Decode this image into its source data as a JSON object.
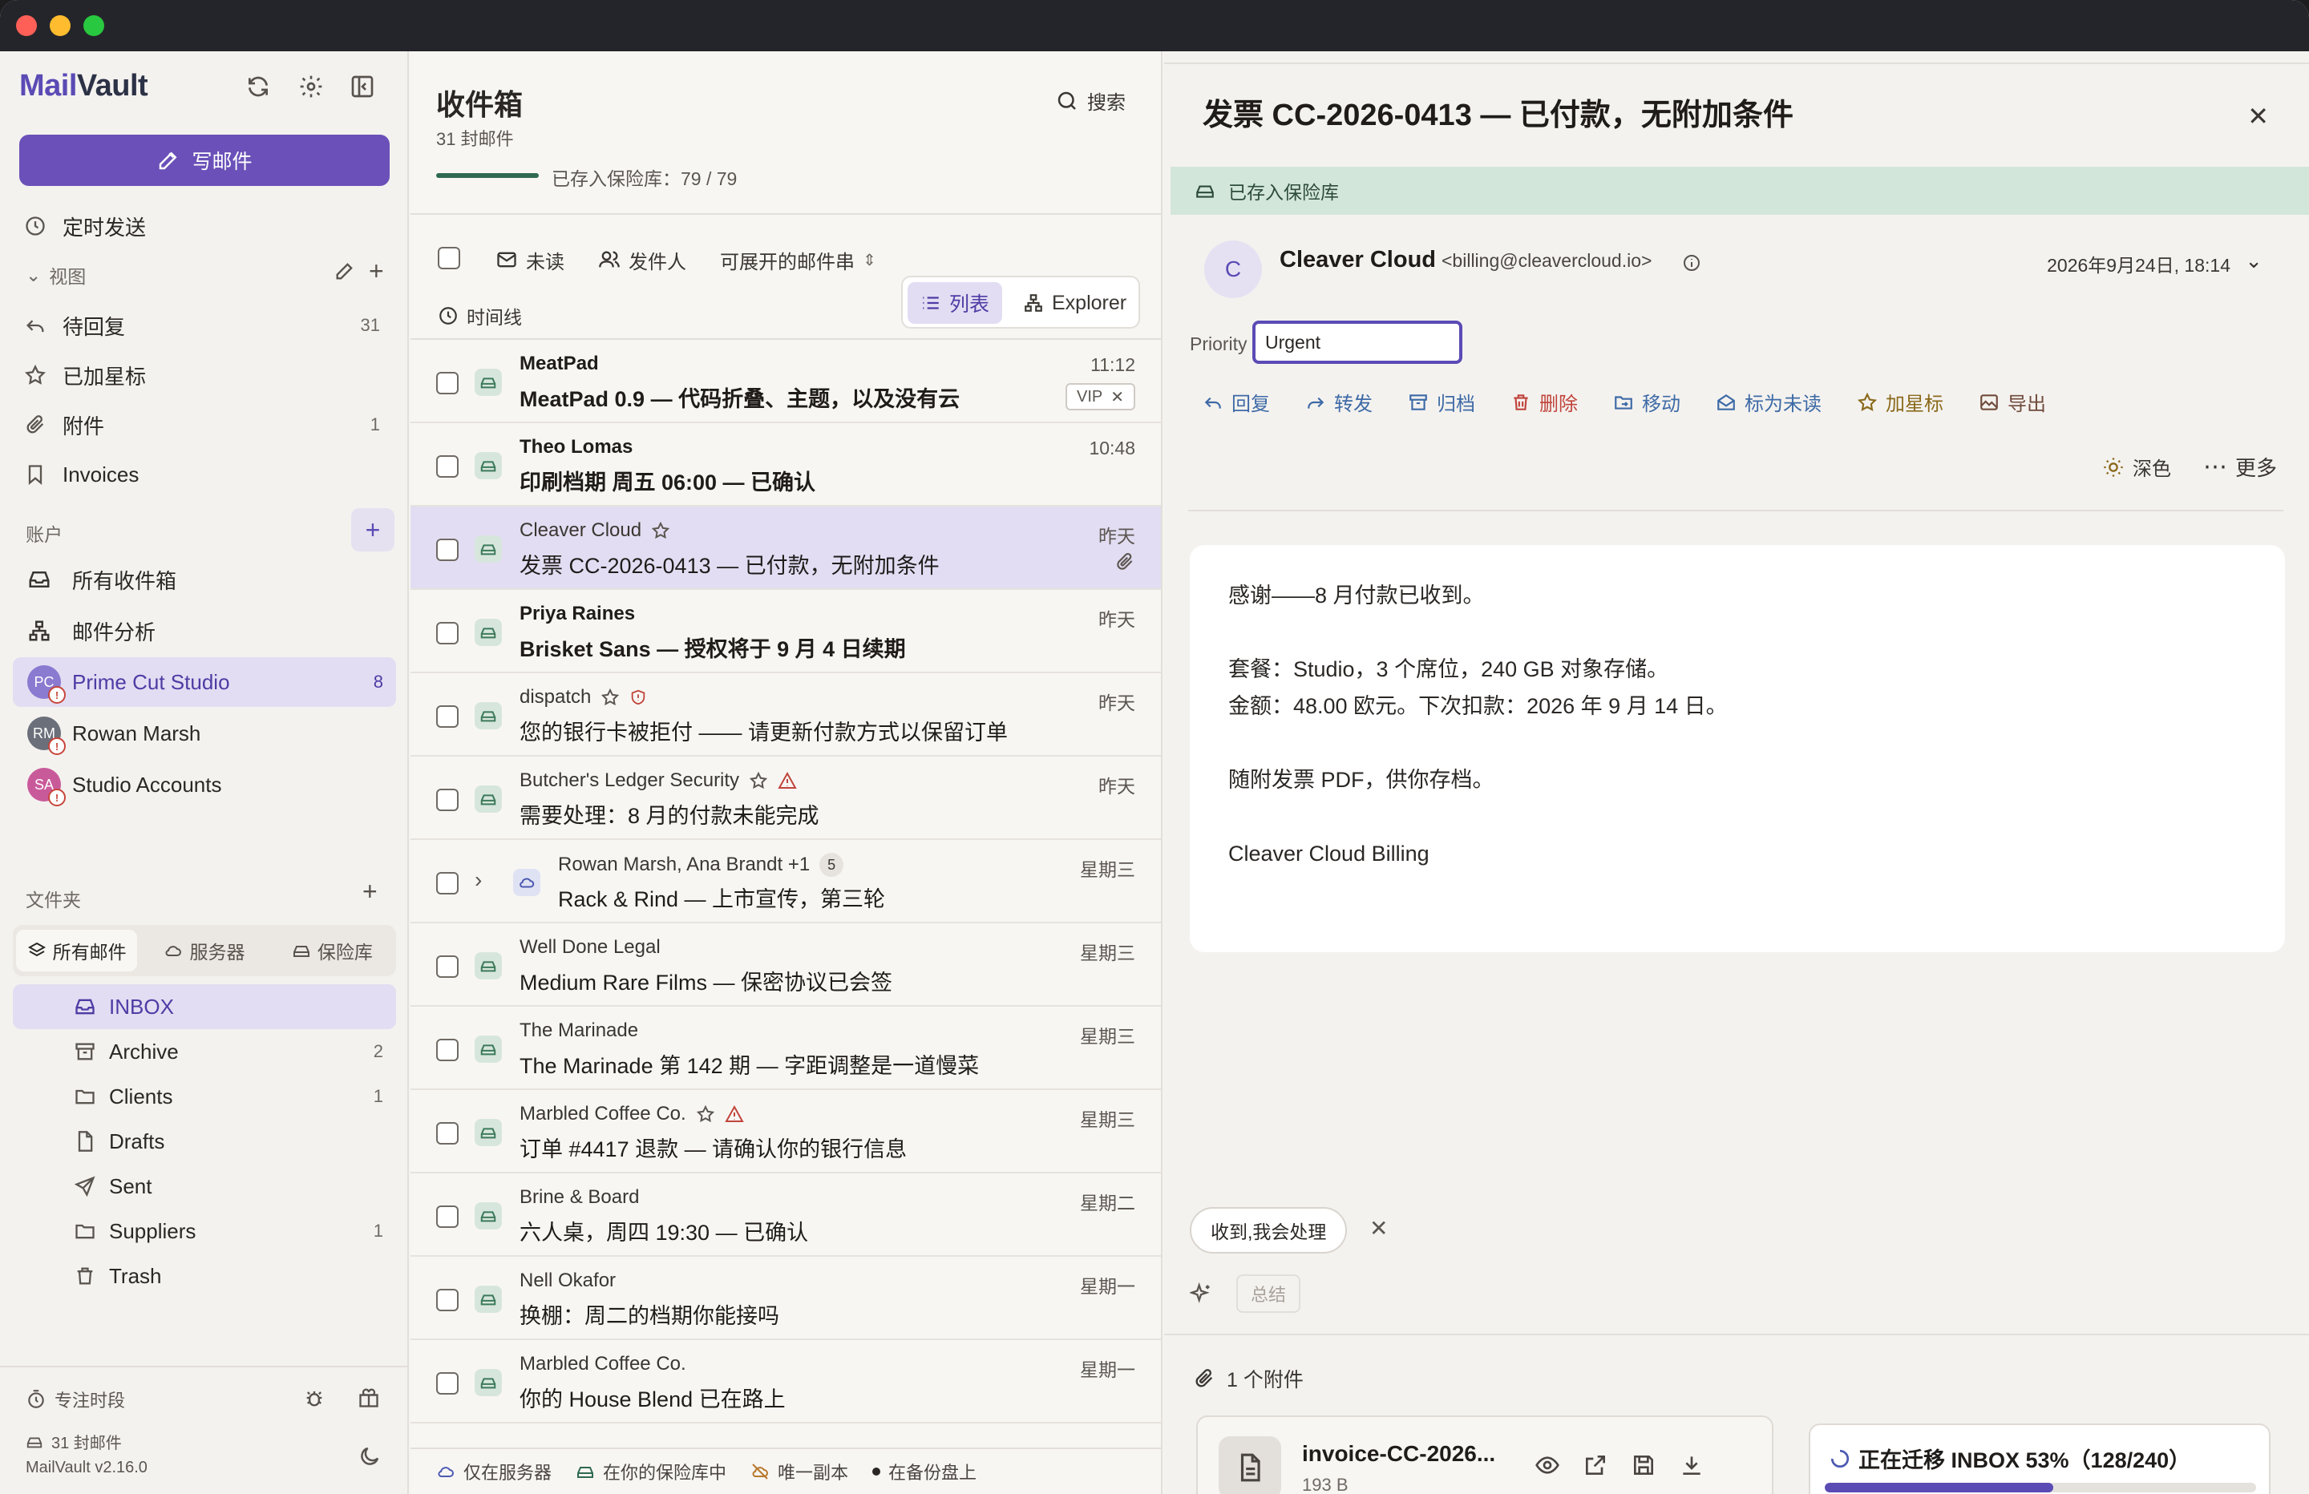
{
  "app": {
    "brand_prefix": "Mail",
    "brand_suffix": "Vault"
  },
  "sidebar": {
    "compose_label": "写邮件",
    "scheduled_label": "定时发送",
    "views_title": "视图",
    "views": [
      {
        "label": "待回复",
        "count": "31",
        "icon": "reply-icon"
      },
      {
        "label": "已加星标",
        "count": "",
        "icon": "star-icon"
      },
      {
        "label": "附件",
        "count": "1",
        "icon": "paperclip-icon"
      },
      {
        "label": "Invoices",
        "count": "",
        "icon": "bookmark-icon"
      }
    ],
    "accounts_title": "账户",
    "account_items": [
      {
        "label": "所有收件箱",
        "icon": "inbox-icon"
      },
      {
        "label": "邮件分析",
        "icon": "analytics-icon"
      }
    ],
    "accounts": [
      {
        "name": "Prime Cut Studio",
        "initials": "PC",
        "count": "8",
        "color": "#8a7ad0",
        "active": true
      },
      {
        "name": "Rowan Marsh",
        "initials": "RM",
        "count": "",
        "color": "#6b6f7a",
        "active": false
      },
      {
        "name": "Studio Accounts",
        "initials": "SA",
        "count": "",
        "color": "#c95a9a",
        "active": false
      }
    ],
    "folders_title": "文件夹",
    "segments": [
      "所有邮件",
      "服务器",
      "保险库"
    ],
    "folders": [
      {
        "label": "INBOX",
        "count": "",
        "icon": "inbox-icon",
        "active": true
      },
      {
        "label": "Archive",
        "count": "2",
        "icon": "archive-icon"
      },
      {
        "label": "Clients",
        "count": "1",
        "icon": "folder-icon"
      },
      {
        "label": "Drafts",
        "count": "",
        "icon": "file-icon"
      },
      {
        "label": "Sent",
        "count": "",
        "icon": "send-icon"
      },
      {
        "label": "Suppliers",
        "count": "1",
        "icon": "folder-icon"
      },
      {
        "label": "Trash",
        "count": "",
        "icon": "trash-icon"
      }
    ],
    "footer": {
      "focus_label": "专注时段",
      "mail_count": "31 封邮件",
      "version": "MailVault v2.16.0"
    }
  },
  "list": {
    "title": "收件箱",
    "subtitle": "31 封邮件",
    "search_label": "搜索",
    "vault_progress_text": "已存入保险库：79 / 79",
    "filters": {
      "unread": "未读",
      "sender": "发件人",
      "threads": "可展开的邮件串",
      "timeline": "时间线"
    },
    "views": {
      "list": "列表",
      "explorer": "Explorer"
    },
    "rows": [
      {
        "from": "MeatPad",
        "subject": "MeatPad 0.9 — 代码折叠、主题，以及没有云",
        "time": "11:12",
        "bold": true,
        "vip": "VIP"
      },
      {
        "from": "Theo Lomas",
        "subject": "印刷档期 周五 06:00 — 已确认",
        "time": "10:48",
        "bold": true
      },
      {
        "from": "Cleaver Cloud",
        "subject": "发票 CC-2026-0413 — 已付款，无附加条件",
        "time": "昨天",
        "bold": false,
        "star": true,
        "attach": true,
        "selected": true
      },
      {
        "from": "Priya Raines",
        "subject": "Brisket Sans — 授权将于 9 月 4 日续期",
        "time": "昨天",
        "bold": true
      },
      {
        "from": "dispatch",
        "subject": "您的银行卡被拒付 —— 请更新付款方式以保留订单",
        "time": "昨天",
        "bold": false,
        "star": true,
        "shield": true
      },
      {
        "from": "Butcher's Ledger Security",
        "subject": "需要处理：8 月的付款未能完成",
        "time": "昨天",
        "bold": false,
        "star": true,
        "warn": true
      },
      {
        "from": "Rowan Marsh, Ana Brandt +1",
        "subject": "Rack & Rind — 上市宣传，第三轮",
        "time": "星期三",
        "bold": false,
        "thread": "5"
      },
      {
        "from": "Well Done Legal",
        "subject": "Medium Rare Films — 保密协议已会签",
        "time": "星期三",
        "bold": false
      },
      {
        "from": "The Marinade",
        "subject": "The Marinade 第 142 期 — 字距调整是一道慢菜",
        "time": "星期三",
        "bold": false
      },
      {
        "from": "Marbled Coffee Co.",
        "subject": "订单 #4417 退款 — 请确认你的银行信息",
        "time": "星期三",
        "bold": false,
        "star": true,
        "warn": true
      },
      {
        "from": "Brine & Board",
        "subject": "六人桌，周四 19:30 — 已确认",
        "time": "星期二",
        "bold": false
      },
      {
        "from": "Nell Okafor",
        "subject": "换棚：周二的档期你能接吗",
        "time": "星期一",
        "bold": false
      },
      {
        "from": "Marbled Coffee Co.",
        "subject": "你的 House Blend 已在路上",
        "time": "星期一",
        "bold": false
      }
    ],
    "footer": {
      "server_only": "仅在服务器",
      "in_vault": "在你的保险库中",
      "only_copy": "唯一副本",
      "on_backup": "在备份盘上"
    }
  },
  "reader": {
    "title": "发票 CC-2026-0413 — 已付款，无附加条件",
    "vault_banner": "已存入保险库",
    "sender_initial": "C",
    "sender_name": "Cleaver Cloud",
    "sender_email": "<billing@cleavercloud.io>",
    "date": "2026年9月24日, 18:14",
    "priority_label": "Priority",
    "priority_value": "Urgent",
    "actions": {
      "reply": "回复",
      "forward": "转发",
      "archive": "归档",
      "delete": "删除",
      "move": "移动",
      "mark_unread": "标为未读",
      "star": "加星标",
      "export": "导出"
    },
    "theme_label": "深色",
    "more_label": "更多",
    "body": [
      "感谢——8 月付款已收到。",
      "套餐：Studio，3 个席位，240 GB 对象存储。",
      "金额：48.00 欧元。下次扣款：2026 年 9 月 14 日。",
      "随附发票 PDF，供你存档。",
      "Cleaver Cloud Billing"
    ],
    "quick_reply": "收到,我会处理",
    "summary_placeholder": "总结",
    "attachments_label": "1 个附件",
    "attachment": {
      "name": "invoice-CC-2026...",
      "size": "193 B"
    },
    "migration": {
      "text": "正在迁移 INBOX 53%（128/240）",
      "progress": 0.53
    }
  },
  "colors": {
    "accent": "#6a50b8",
    "vault_green": "#2f6a4f",
    "danger": "#c0443b"
  }
}
